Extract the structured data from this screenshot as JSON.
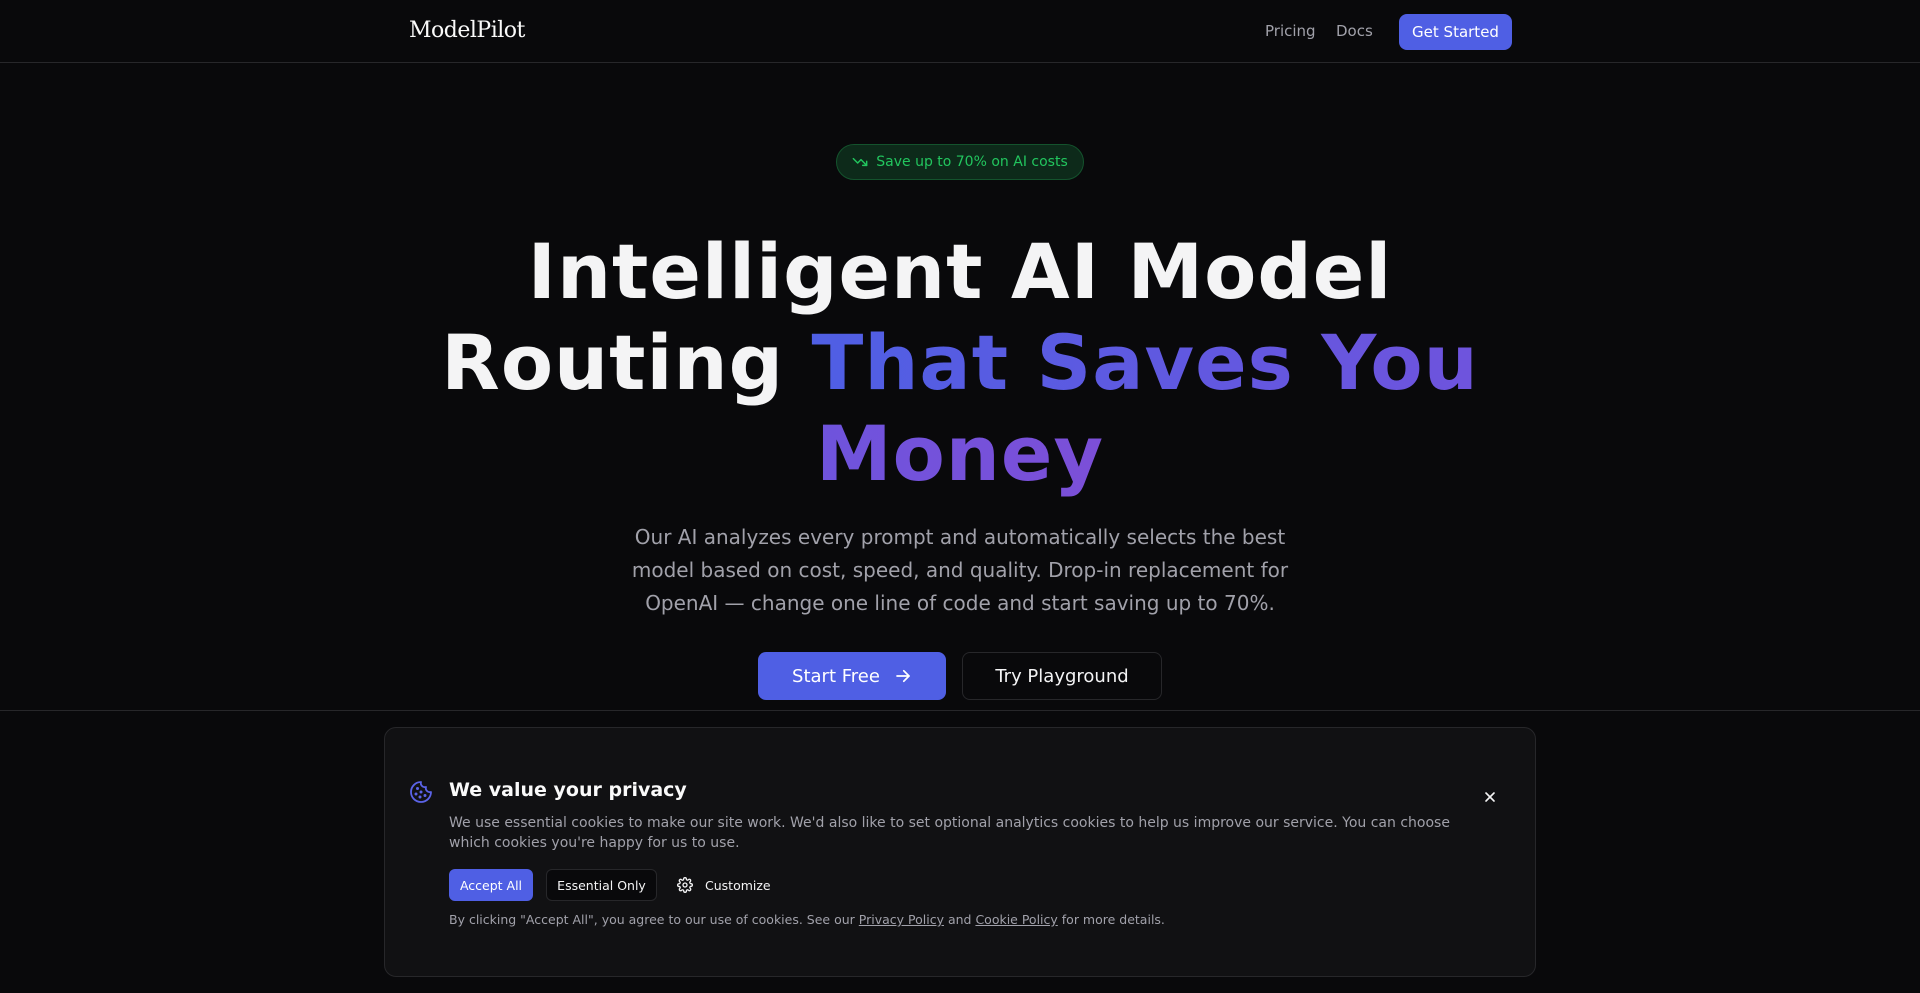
{
  "nav": {
    "brand": "ModelPilot",
    "links": [
      "Pricing",
      "Docs"
    ],
    "cta_label": "Get Started"
  },
  "hero": {
    "badge": "Save up to 70% on AI costs",
    "title_plain": "Intelligent AI Model Routing ",
    "title_highlight": "That Saves You Money",
    "subtitle": "Our AI analyzes every prompt and automatically selects the best model based on cost, speed, and quality. Drop-in replacement for OpenAI — change one line of code and start saving up to 70%.",
    "primary_label": "Start Free",
    "secondary_label": "Try Playground"
  },
  "cookie": {
    "title": "We value your privacy",
    "text": "We use essential cookies to make our site work. We'd also like to set optional analytics cookies to help us improve our service. You can choose which cookies you're happy for us to use.",
    "accept_label": "Accept All",
    "essential_label": "Essential Only",
    "customize_label": "Customize",
    "footer_pre": "By clicking \"Accept All\", you agree to our use of cookies. See our ",
    "privacy_link": "Privacy Policy",
    "footer_and": " and ",
    "cookie_link": "Cookie Policy",
    "footer_post": " for more details."
  },
  "colors": {
    "background": "#09090b",
    "accent": "#4f5fe4",
    "accent_violet": "#7c4fd8",
    "badge_green": "#22c55e",
    "muted_text": "#a1a1aa",
    "border": "#27272a"
  },
  "icons": {
    "badge": "trending-down-icon",
    "start": "arrow-right-icon",
    "cookie": "cookie-icon",
    "close": "close-icon",
    "customize": "gear-icon"
  }
}
